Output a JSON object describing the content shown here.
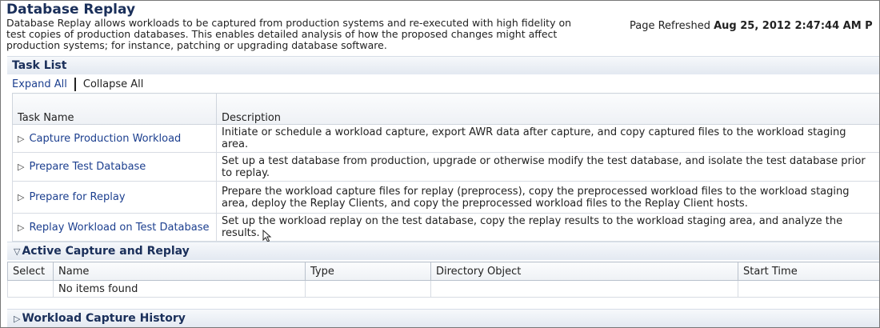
{
  "page": {
    "title": "Database Replay",
    "description": "Database Replay allows workloads to be captured from production systems and re-executed with high fidelity on test copies of production databases. This enables detailed analysis of how the proposed changes might affect production systems; for instance, patching or upgrading database software.",
    "refreshed_label": "Page Refreshed",
    "refreshed_value": "Aug 25, 2012 2:47:44 AM P"
  },
  "task_list": {
    "title": "Task List",
    "expand_all": "Expand All",
    "collapse_all": "Collapse All",
    "columns": [
      "Task Name",
      "Description"
    ],
    "rows": [
      {
        "name": "Capture Production Workload",
        "description": "Initiate or schedule a workload capture, export AWR data after capture, and copy captured files to the workload staging area."
      },
      {
        "name": "Prepare Test Database",
        "description": "Set up a test database from production, upgrade or otherwise modify the test database, and isolate the test database prior to replay."
      },
      {
        "name": "Prepare for Replay",
        "description": "Prepare the workload capture files for replay (preprocess), copy the preprocessed workload files to the workload staging area, deploy the Replay Clients, and copy the preprocessed workload files to the Replay Client hosts."
      },
      {
        "name": "Replay Workload on Test Database",
        "description": "Set up the workload replay on the test database, copy the replay results to the workload staging area, and analyze the results."
      }
    ]
  },
  "active_capture": {
    "title": "Active Capture and Replay",
    "columns": [
      "Select",
      "Name",
      "Type",
      "Directory Object",
      "Start Time"
    ],
    "empty_text": "No items found"
  },
  "history": {
    "title": "Workload Capture History"
  },
  "icons": {
    "expand": "triangle-right-icon",
    "collapse": "triangle-down-icon",
    "cursor": "mouse-pointer-icon"
  },
  "colors": {
    "heading": "#1a2f5a",
    "link": "#1c3f8f"
  }
}
